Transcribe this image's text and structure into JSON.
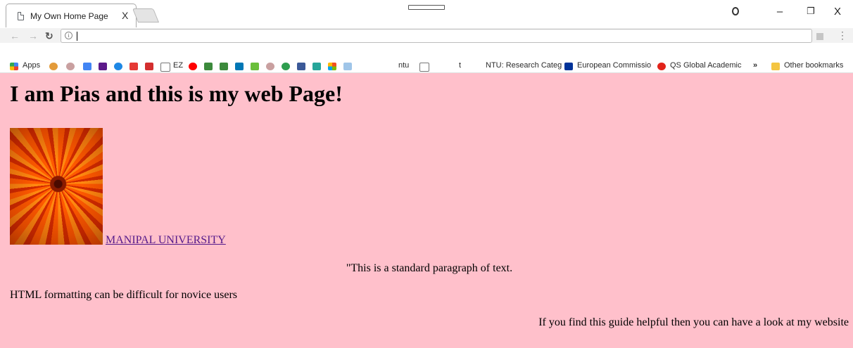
{
  "browser": {
    "tab_title": "My Own Home Page",
    "tab_close": "X",
    "window_controls": {
      "minimize": "–",
      "restore": "❐",
      "close": "X"
    },
    "address_value": "",
    "bookmarks": [
      {
        "label": "Apps"
      },
      {
        "label": "ntu"
      },
      {
        "label": "t"
      },
      {
        "label": "NTU: Research Categ"
      },
      {
        "label": "European Commissio"
      },
      {
        "label": "QS Global Academic"
      },
      {
        "label": "»"
      },
      {
        "label": "Other bookmarks"
      }
    ],
    "icons": [
      "page-icon",
      "profile-icon",
      "back-icon",
      "forward-icon",
      "reload-icon",
      "info-icon",
      "extension-icon",
      "menu-icon",
      "apps-icon",
      "folder-icon"
    ]
  },
  "page": {
    "background_color": "#ffc0cb",
    "heading": "I am Pias and this is my web Page!",
    "image_alt": "flower",
    "link_text": "MANIPAL UNIVERSITY",
    "link_color": "#551a8b",
    "paragraph_center": "\"This is a standard paragraph of text.",
    "paragraph_left": "HTML formatting can be difficult for novice users",
    "paragraph_right": "If you find this guide helpful then you can have a look at my website"
  }
}
